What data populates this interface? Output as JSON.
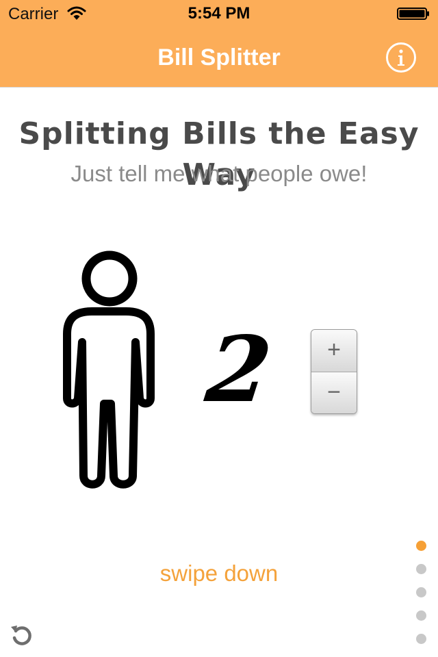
{
  "status_bar": {
    "carrier": "Carrier",
    "time": "5:54 PM",
    "wifi_icon": "wifi-icon",
    "battery_icon": "battery-icon"
  },
  "nav": {
    "title": "Bill Splitter",
    "info_icon": "info-icon"
  },
  "content": {
    "headline": "Splitting Bills the Easy Way",
    "subhead": "Just tell me what people owe!",
    "person_icon": "person-icon",
    "people_count": "2",
    "stepper": {
      "plus": "+",
      "minus": "−"
    },
    "swipe_hint": "swipe down"
  },
  "page_indicator": {
    "total": 5,
    "current": 1
  },
  "colors": {
    "header": "#fcad58",
    "accent": "#f6a036",
    "headline": "#4a4a4a",
    "subhead": "#8a8a8a"
  }
}
